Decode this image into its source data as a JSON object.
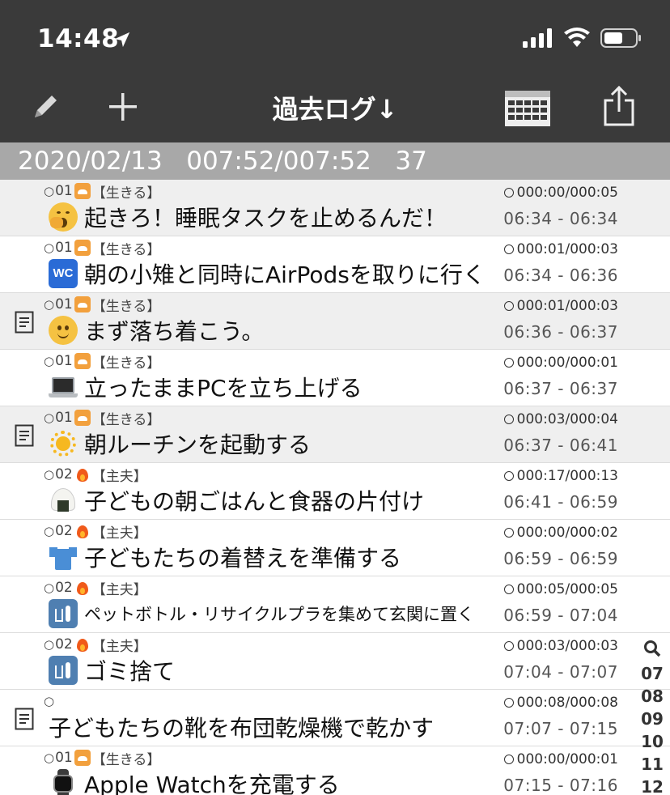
{
  "status_bar": {
    "time": "14:48"
  },
  "nav": {
    "title": "過去ログ↓"
  },
  "date_header": {
    "text": "2020/02/13   007:52/007:52   37"
  },
  "rows": [
    {
      "shaded": true,
      "memo": false,
      "rep": "○",
      "level": "01",
      "cat_icon": "sleep-icon",
      "category": "【生きる】",
      "emoji": "yawning-face-icon",
      "title": "起きろ！睡眠タスクを止めるんだ！",
      "duration": "000:00/000:05",
      "range": "06:34 - 06:34"
    },
    {
      "shaded": false,
      "memo": false,
      "rep": "○",
      "level": "01",
      "cat_icon": "sleep-icon",
      "category": "【生きる】",
      "emoji": "wc-icon",
      "title": "朝の小雉と同時にAirPodsを取りに行く",
      "duration": "000:01/000:03",
      "range": "06:34 - 06:36"
    },
    {
      "shaded": true,
      "memo": true,
      "rep": "○",
      "level": "01",
      "cat_icon": "sleep-icon",
      "category": "【生きる】",
      "emoji": "smiling-face-icon",
      "title": "まず落ち着こう。",
      "duration": "000:01/000:03",
      "range": "06:36 - 06:37"
    },
    {
      "shaded": false,
      "memo": false,
      "rep": "○",
      "level": "01",
      "cat_icon": "sleep-icon",
      "category": "【生きる】",
      "emoji": "laptop-icon",
      "title": "立ったままPCを立ち上げる",
      "duration": "000:00/000:01",
      "range": "06:37 - 06:37"
    },
    {
      "shaded": true,
      "memo": true,
      "rep": "○",
      "level": "01",
      "cat_icon": "sleep-icon",
      "category": "【生きる】",
      "emoji": "sun-icon",
      "title": "朝ルーチンを起動する",
      "duration": "000:03/000:04",
      "range": "06:37 - 06:41"
    },
    {
      "shaded": false,
      "memo": false,
      "rep": "○",
      "level": "02",
      "cat_icon": "fire-icon",
      "category": "【主夫】",
      "emoji": "onigiri-icon",
      "title": "子どもの朝ごはんと食器の片付け",
      "duration": "000:17/000:13",
      "range": "06:41 - 06:59"
    },
    {
      "shaded": false,
      "memo": false,
      "rep": "○",
      "level": "02",
      "cat_icon": "fire-icon",
      "category": "【主夫】",
      "emoji": "shirt-icon",
      "title": "子どもたちの着替えを準備する",
      "duration": "000:00/000:02",
      "range": "06:59 - 06:59"
    },
    {
      "shaded": false,
      "memo": false,
      "rep": "○",
      "level": "02",
      "cat_icon": "fire-icon",
      "category": "【主夫】",
      "emoji": "trash-icon",
      "title": "ペットボトル・リサイクルプラを集めて玄関に置く",
      "duration": "000:05/000:05",
      "range": "06:59 - 07:04",
      "small": true
    },
    {
      "shaded": false,
      "memo": false,
      "rep": "○",
      "level": "02",
      "cat_icon": "fire-icon",
      "category": "【主夫】",
      "emoji": "trash-icon",
      "title": "ゴミ捨て",
      "duration": "000:03/000:03",
      "range": "07:04 - 07:07"
    },
    {
      "shaded": false,
      "memo": true,
      "rep": "○",
      "level": "",
      "cat_icon": "",
      "category": "",
      "emoji": "",
      "title": "子どもたちの靴を布団乾燥機で乾かす",
      "duration": "000:08/000:08",
      "range": "07:07 - 07:15"
    },
    {
      "shaded": false,
      "memo": false,
      "rep": "○",
      "level": "01",
      "cat_icon": "sleep-icon",
      "category": "【生きる】",
      "emoji": "watch-icon",
      "title": "Apple Watchを充電する",
      "duration": "000:00/000:01",
      "range": "07:15 - 07:16"
    }
  ],
  "side_index": [
    "07",
    "08",
    "09",
    "10",
    "11",
    "12"
  ],
  "colors": {
    "bar": "#3a3a3a",
    "date_header": "#a8a8a8",
    "shaded_row": "#efefef"
  }
}
